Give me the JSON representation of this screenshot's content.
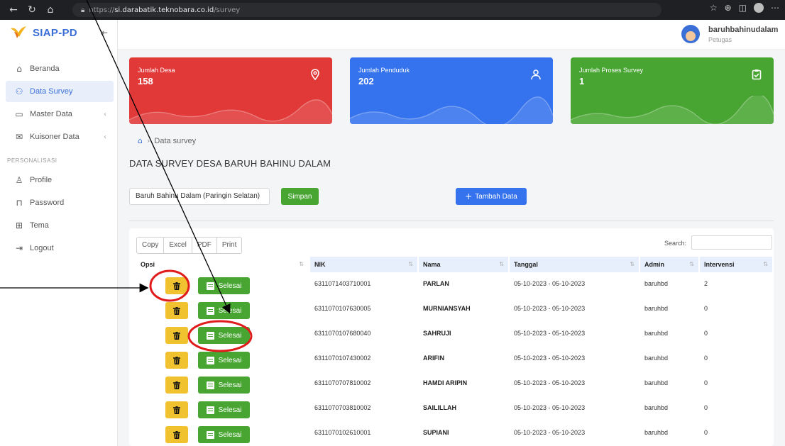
{
  "browser": {
    "url_prefix": "https://",
    "url_host": "si.darabatik.teknobara.co.id",
    "url_path": "/survey",
    "nav_icons": [
      "back-arrow-icon",
      "refresh-icon",
      "home-icon"
    ]
  },
  "app": {
    "name": "SIAP-PD",
    "brand_color": "#3b6fd8"
  },
  "user": {
    "name": "baruhbahinudalam",
    "role": "Petugas"
  },
  "sidebar": {
    "items": [
      {
        "label": "Beranda",
        "icon": "home-icon",
        "glyph": "⌂",
        "active": false,
        "has_chevron": false
      },
      {
        "label": "Data Survey",
        "icon": "users-icon",
        "glyph": "👥",
        "active": true,
        "has_chevron": false
      },
      {
        "label": "Master Data",
        "icon": "folder-icon",
        "glyph": "▭",
        "active": false,
        "has_chevron": true
      },
      {
        "label": "Kuisoner Data",
        "icon": "mail-icon",
        "glyph": "✉",
        "active": false,
        "has_chevron": true
      }
    ],
    "section_label": "PERSONALISASI",
    "personal_items": [
      {
        "label": "Profile",
        "icon": "user-icon",
        "glyph": "⚇"
      },
      {
        "label": "Password",
        "icon": "lock-icon",
        "glyph": "🔒"
      },
      {
        "label": "Tema",
        "icon": "grid-icon",
        "glyph": "⊞"
      },
      {
        "label": "Logout",
        "icon": "logout-icon",
        "glyph": "⇥"
      }
    ]
  },
  "stats": [
    {
      "title": "Jumlah Desa",
      "value": "158",
      "icon": "map-pin-icon",
      "color": "#e13838"
    },
    {
      "title": "Jumlah Penduduk",
      "value": "202",
      "icon": "user-icon",
      "color": "#3572ed"
    },
    {
      "title": "Jumlah Proses Survey",
      "value": "1",
      "icon": "clipboard-check-icon",
      "color": "#48a532"
    }
  ],
  "breadcrumb": {
    "current": "Data survey"
  },
  "page_title": "DATA SURVEY DESA BARUH BAHINU DALAM",
  "village_select": {
    "value": "Baruh Bahinu Dalam (Paringin Selatan)"
  },
  "buttons": {
    "save": "Simpan",
    "add": "Tambah Data",
    "add_glyph": "+"
  },
  "table": {
    "export_buttons": [
      "Copy",
      "Excel",
      "PDF",
      "Print"
    ],
    "search_label": "Search:",
    "headers": [
      "Opsi",
      "NIK",
      "Nama",
      "Tanggal",
      "Admin",
      "Intervensi"
    ],
    "action_label": "Selesai",
    "rows": [
      {
        "nik": "6311071403710001",
        "nama": "PARLAN",
        "tanggal": "05-10-2023 - 05-10-2023",
        "admin": "baruhbd",
        "intervensi": "2"
      },
      {
        "nik": "6311070107630005",
        "nama": "MURNIANSYAH",
        "tanggal": "05-10-2023 - 05-10-2023",
        "admin": "baruhbd",
        "intervensi": "0"
      },
      {
        "nik": "6311070107680040",
        "nama": "SAHRUJI",
        "tanggal": "05-10-2023 - 05-10-2023",
        "admin": "baruhbd",
        "intervensi": "0"
      },
      {
        "nik": "6311070107430002",
        "nama": "ARIFIN",
        "tanggal": "05-10-2023 - 05-10-2023",
        "admin": "baruhbd",
        "intervensi": "0"
      },
      {
        "nik": "6311070707810002",
        "nama": "HAMDI ARIPIN",
        "tanggal": "05-10-2023 - 05-10-2023",
        "admin": "baruhbd",
        "intervensi": "0"
      },
      {
        "nik": "6311070703810002",
        "nama": "SAILILLAH",
        "tanggal": "05-10-2023 - 05-10-2023",
        "admin": "baruhbd",
        "intervensi": "0"
      },
      {
        "nik": "6311070102610001",
        "nama": "SUPIANI",
        "tanggal": "05-10-2023 - 05-10-2023",
        "admin": "baruhbd",
        "intervensi": "0"
      }
    ]
  },
  "colors": {
    "red": "#e13838",
    "blue": "#3572ed",
    "green": "#48a532",
    "yellow": "#f1c22f",
    "annotation_red": "#e01b1b"
  }
}
